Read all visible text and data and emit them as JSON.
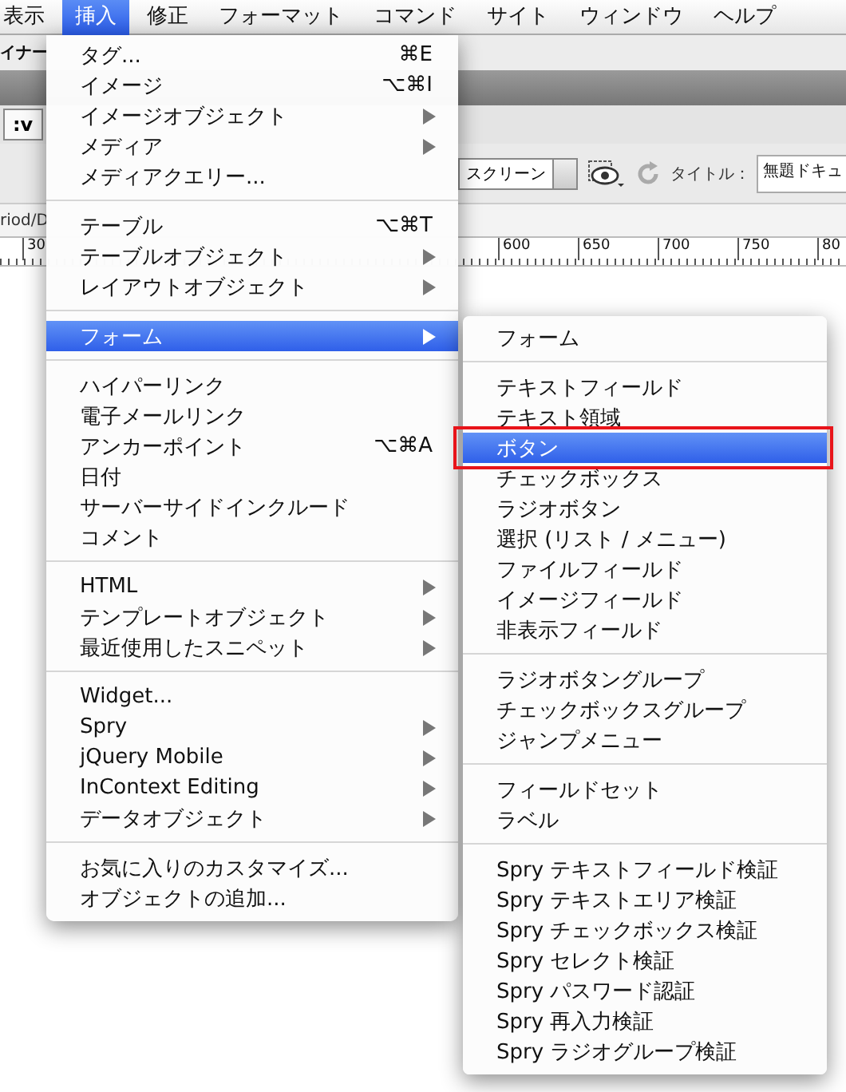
{
  "menu_bar": [
    {
      "label": "表示",
      "selected": false
    },
    {
      "label": "挿入",
      "selected": true
    },
    {
      "label": "修正",
      "selected": false
    },
    {
      "label": "フォーマット",
      "selected": false
    },
    {
      "label": "コマンド",
      "selected": false
    },
    {
      "label": "サイト",
      "selected": false
    },
    {
      "label": "ウィンドウ",
      "selected": false
    },
    {
      "label": "ヘルプ",
      "selected": false
    }
  ],
  "background": {
    "panel_label": "イナー",
    "code_button": ":v",
    "view_dropdown": "スクリーン",
    "title_label": "タイトル：",
    "title_field": "無題ドキュ",
    "path": "riod/D",
    "ruler_labels": [
      "30",
      "600",
      "650",
      "700",
      "750",
      "80"
    ]
  },
  "main_menu": {
    "groups": [
      {
        "items": [
          {
            "label": "タグ...",
            "shortcut": "⌘E",
            "submenu": false,
            "selected": false
          },
          {
            "label": "イメージ",
            "shortcut": "⌥⌘I",
            "submenu": false,
            "selected": false
          },
          {
            "label": "イメージオブジェクト",
            "submenu": true,
            "selected": false
          },
          {
            "label": "メディア",
            "submenu": true,
            "selected": false
          },
          {
            "label": "メディアクエリー...",
            "submenu": false,
            "selected": false
          }
        ]
      },
      {
        "items": [
          {
            "label": "テーブル",
            "shortcut": "⌥⌘T",
            "submenu": false,
            "selected": false
          },
          {
            "label": "テーブルオブジェクト",
            "submenu": true,
            "selected": false
          },
          {
            "label": "レイアウトオブジェクト",
            "submenu": true,
            "selected": false
          }
        ]
      },
      {
        "items": [
          {
            "label": "フォーム",
            "submenu": true,
            "selected": true
          }
        ]
      },
      {
        "items": [
          {
            "label": "ハイパーリンク",
            "submenu": false,
            "selected": false
          },
          {
            "label": "電子メールリンク",
            "submenu": false,
            "selected": false
          },
          {
            "label": "アンカーポイント",
            "shortcut": "⌥⌘A",
            "submenu": false,
            "selected": false
          },
          {
            "label": "日付",
            "submenu": false,
            "selected": false
          },
          {
            "label": "サーバーサイドインクルード",
            "submenu": false,
            "selected": false
          },
          {
            "label": "コメント",
            "submenu": false,
            "selected": false
          }
        ]
      },
      {
        "items": [
          {
            "label": "HTML",
            "submenu": true,
            "selected": false
          },
          {
            "label": "テンプレートオブジェクト",
            "submenu": true,
            "selected": false
          },
          {
            "label": "最近使用したスニペット",
            "submenu": true,
            "selected": false
          }
        ]
      },
      {
        "items": [
          {
            "label": "Widget...",
            "submenu": false,
            "selected": false
          },
          {
            "label": "Spry",
            "submenu": true,
            "selected": false
          },
          {
            "label": "jQuery Mobile",
            "submenu": true,
            "selected": false
          },
          {
            "label": "InContext Editing",
            "submenu": true,
            "selected": false
          },
          {
            "label": "データオブジェクト",
            "submenu": true,
            "selected": false
          }
        ]
      },
      {
        "items": [
          {
            "label": "お気に入りのカスタマイズ...",
            "submenu": false,
            "selected": false
          },
          {
            "label": "オブジェクトの追加...",
            "submenu": false,
            "selected": false
          }
        ]
      }
    ]
  },
  "submenu": {
    "groups": [
      {
        "items": [
          {
            "label": "フォーム",
            "selected": false,
            "annotated": false
          }
        ]
      },
      {
        "items": [
          {
            "label": "テキストフィールド",
            "selected": false,
            "annotated": false
          },
          {
            "label": "テキスト領域",
            "selected": false,
            "annotated": false
          },
          {
            "label": "ボタン",
            "selected": true,
            "annotated": true
          },
          {
            "label": "チェックボックス",
            "selected": false,
            "annotated": false
          },
          {
            "label": "ラジオボタン",
            "selected": false,
            "annotated": false
          },
          {
            "label": "選択 (リスト / メニュー)",
            "selected": false,
            "annotated": false
          },
          {
            "label": "ファイルフィールド",
            "selected": false,
            "annotated": false
          },
          {
            "label": "イメージフィールド",
            "selected": false,
            "annotated": false
          },
          {
            "label": "非表示フィールド",
            "selected": false,
            "annotated": false
          }
        ]
      },
      {
        "items": [
          {
            "label": "ラジオボタングループ",
            "selected": false,
            "annotated": false
          },
          {
            "label": "チェックボックスグループ",
            "selected": false,
            "annotated": false
          },
          {
            "label": "ジャンプメニュー",
            "selected": false,
            "annotated": false
          }
        ]
      },
      {
        "items": [
          {
            "label": "フィールドセット",
            "selected": false,
            "annotated": false
          },
          {
            "label": "ラベル",
            "selected": false,
            "annotated": false
          }
        ]
      },
      {
        "items": [
          {
            "label": "Spry テキストフィールド検証",
            "selected": false,
            "annotated": false
          },
          {
            "label": "Spry テキストエリア検証",
            "selected": false,
            "annotated": false
          },
          {
            "label": "Spry チェックボックス検証",
            "selected": false,
            "annotated": false
          },
          {
            "label": "Spry セレクト検証",
            "selected": false,
            "annotated": false
          },
          {
            "label": "Spry パスワード認証",
            "selected": false,
            "annotated": false
          },
          {
            "label": "Spry 再入力検証",
            "selected": false,
            "annotated": false
          },
          {
            "label": "Spry ラジオグループ検証",
            "selected": false,
            "annotated": false
          }
        ]
      }
    ]
  }
}
